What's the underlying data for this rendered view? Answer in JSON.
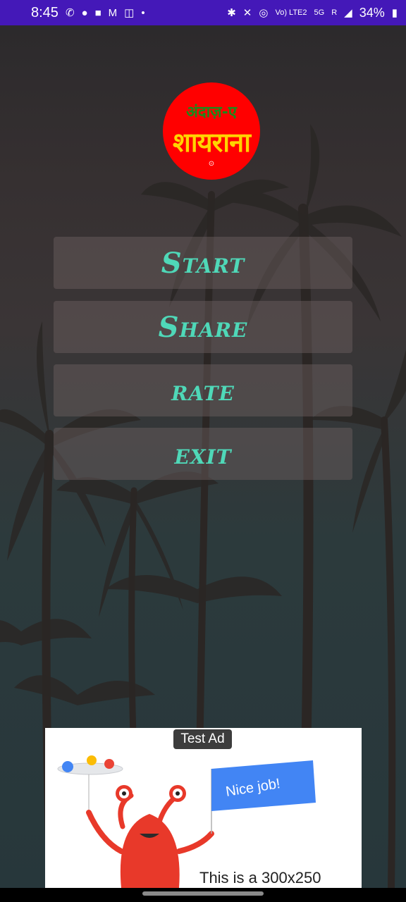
{
  "status_bar": {
    "time": "8:45",
    "left_icons": [
      "phone-icon",
      "app-icon",
      "app-icon",
      "gmail-icon",
      "lock-icon",
      "dot-icon"
    ],
    "network_label": "Vo) LTE2",
    "network_gen": "5G",
    "signal_label": "R",
    "battery": "34%",
    "background_color": "#4418b8"
  },
  "logo": {
    "line1": "अंदाज़-ए",
    "line2": "शायराना",
    "mark": "⊙",
    "background_color": "#ff0000"
  },
  "menu": {
    "items": [
      {
        "label": "Start"
      },
      {
        "label": "Share"
      },
      {
        "label": "rate"
      },
      {
        "label": "exit"
      }
    ],
    "label_color": "#4fd8b8"
  },
  "ad": {
    "badge": "Test Ad",
    "flag_text": "Nice job!",
    "caption": "This is a 300x250"
  }
}
